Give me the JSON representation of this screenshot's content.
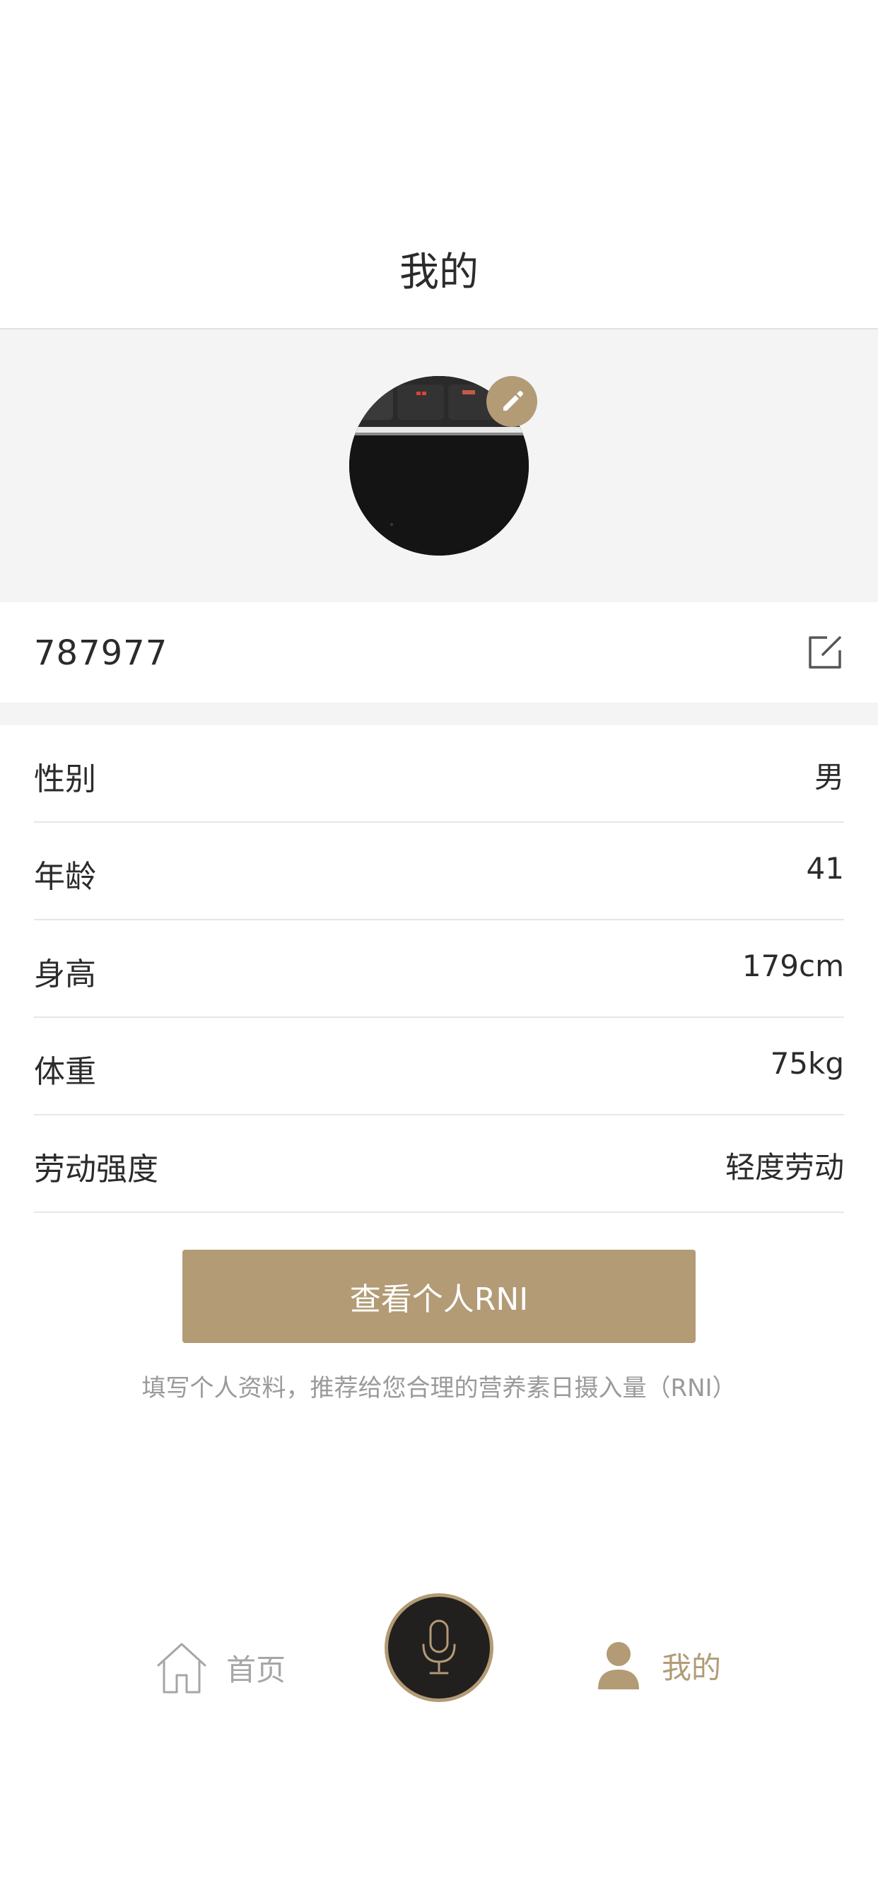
{
  "header": {
    "title": "我的"
  },
  "profile": {
    "avatar_icon": "avatar-photo",
    "edit_avatar_icon": "pencil-icon",
    "username": "787977",
    "edit_username_icon": "edit-square-icon"
  },
  "info": [
    {
      "label": "性别",
      "value": "男"
    },
    {
      "label": "年龄",
      "value": "41"
    },
    {
      "label": "身高",
      "value": "179cm"
    },
    {
      "label": "体重",
      "value": "75kg"
    },
    {
      "label": "劳动强度",
      "value": "轻度劳动"
    }
  ],
  "rni": {
    "button_label": "查看个人RNI",
    "hint": "填写个人资料，推荐给您合理的营养素日摄入量（RNI）"
  },
  "tabbar": {
    "home_label": "首页",
    "home_icon": "home-icon",
    "mic_icon": "microphone-icon",
    "mine_label": "我的",
    "mine_icon": "user-icon"
  },
  "colors": {
    "accent": "#b29b75",
    "background_gray": "#f4f4f4",
    "text": "#2b2b2b",
    "hint_text": "#9a9a9a",
    "mic_bg": "#221f1f"
  }
}
